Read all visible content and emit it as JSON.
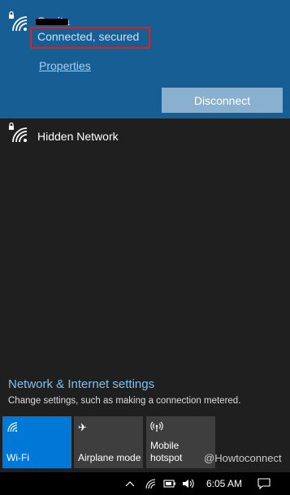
{
  "connected_network": {
    "name": "Sunita",
    "status": "Connected, secured",
    "properties_label": "Properties",
    "disconnect_label": "Disconnect"
  },
  "hidden_network": {
    "name": "Hidden Network"
  },
  "settings": {
    "title": "Network & Internet settings",
    "description": "Change settings, such as making a connection metered."
  },
  "quick_actions": [
    {
      "label": "Wi-Fi",
      "icon": "wifi-icon",
      "active": true
    },
    {
      "label": "Airplane mode",
      "icon": "airplane-icon",
      "active": false
    },
    {
      "label": "Mobile\nhotspot",
      "icon": "hotspot-icon",
      "active": false
    }
  ],
  "watermark": "@Howtoconnect",
  "taskbar": {
    "time": "6:05 AM"
  },
  "colors": {
    "accent": "#0078d7",
    "connected_bg": "#175e94",
    "link": "#7cc2f3",
    "highlight": "#e0201b"
  }
}
